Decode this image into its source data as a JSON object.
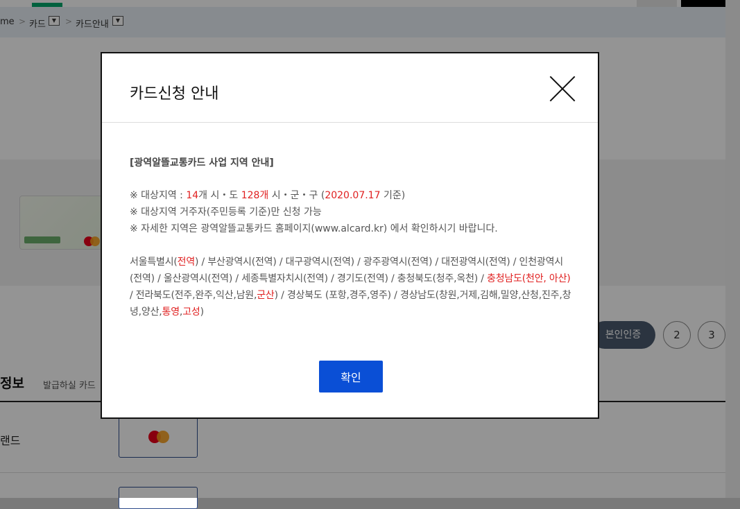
{
  "breadcrumb": {
    "home": "me",
    "item1": "카드",
    "item2": "카드안내",
    "dropdown_glyph": "▼",
    "separator": ">"
  },
  "steps": {
    "step1_label": "본인인증",
    "step2_label": "2",
    "step3_label": "3"
  },
  "section": {
    "title": "정보",
    "subtitle": "발급하실 카드",
    "brand_label": "랜드"
  },
  "modal": {
    "title": "카드신청 안내",
    "close_icon": "close-x-icon",
    "heading": "[광역알뜰교통카드 사업 지역 안내]",
    "notice1": {
      "prefix": "※ 대상지역 : ",
      "count_cities": "14",
      "mid1": "개 시・도 ",
      "count_districts": "128개",
      "mid2": " 시・군・구 (",
      "date": "2020.07.17",
      "suffix": " 기준)"
    },
    "notice2": "※ 대상지역 거주자(주민등록 기준)만 신청 가능",
    "notice3": "※ 자세한 지역은 광역알뜰교통카드 홈페이지(www.alcard.kr) 에서 확인하시기 바랍니다.",
    "regions": {
      "seoul": "서울특별시(",
      "seoul_red": "전역",
      "seg1": ") / 부산광역시(전역) / 대구광역시(전역) / 광주광역시(전역) / 대전광역시(전역) / 인천광역시(전역) / 울산광역시(전역) / 세종특별자치시(전역) / 경기도(전역) / 충청북도(청주,옥천) / ",
      "chungnam_red": "충청남도(천안, 아산)",
      "seg2": " / 전라북도(전주,완주,익산,남원,",
      "gunsan_red": "군산",
      "seg3": ") / 경상북도 (포항,경주,영주) / 경상남도(창원,거제,김해,밀양,산청,진주,창녕,양산,",
      "tongyeong_red": "통영",
      "comma": ",",
      "goseong_red": "고성",
      "end": ")"
    },
    "confirm_label": "확인"
  },
  "colors": {
    "highlight_red": "#e02020",
    "confirm_blue": "#0a4fd6",
    "step_active": "#4a5a6e"
  }
}
